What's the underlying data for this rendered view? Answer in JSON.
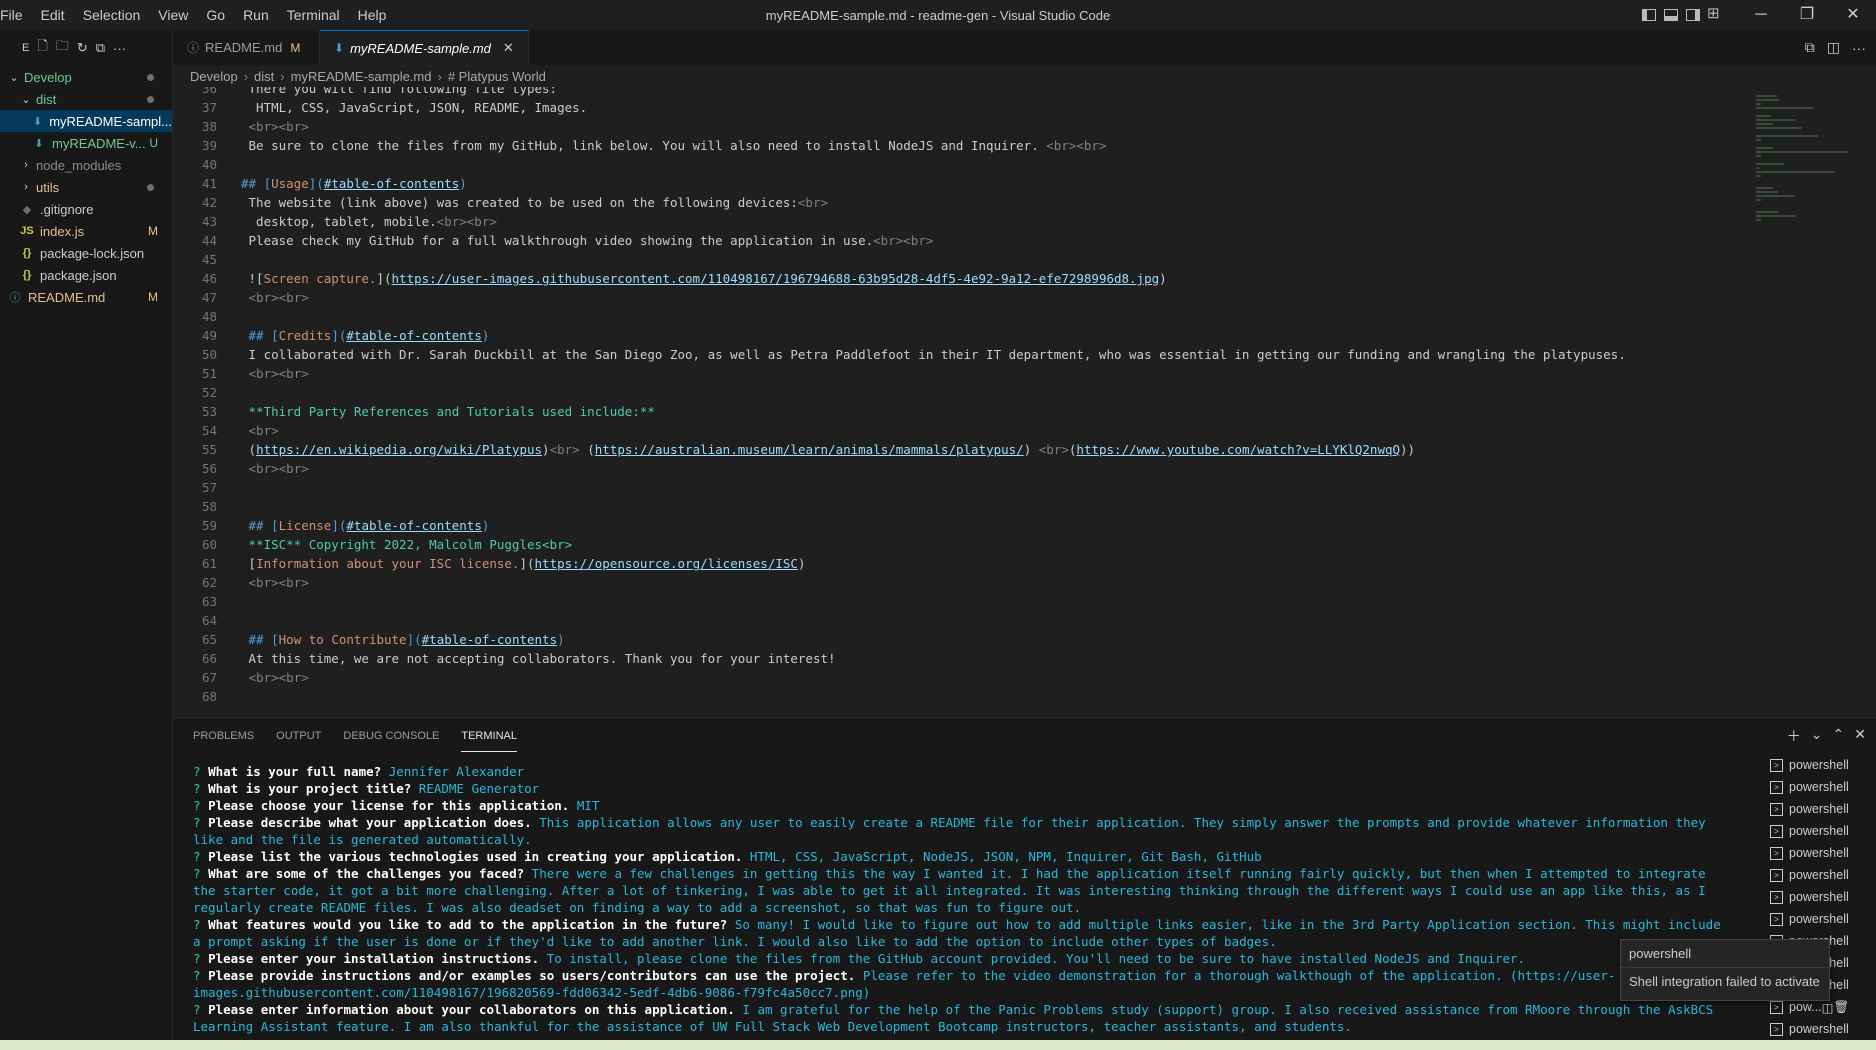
{
  "window": {
    "title": "myREADME-sample.md - readme-gen - Visual Studio Code",
    "menu": [
      "File",
      "Edit",
      "Selection",
      "View",
      "Go",
      "Run",
      "Terminal",
      "Help"
    ]
  },
  "sidebar": {
    "header_label": "E",
    "tree": [
      {
        "label": "Develop",
        "kind": "folder-open",
        "indent": 0,
        "status": "dot",
        "color": "#73c991"
      },
      {
        "label": "dist",
        "kind": "folder-open",
        "indent": 1,
        "status": "dot",
        "color": "#73c991"
      },
      {
        "label": "myREADME-sampl...",
        "kind": "md",
        "indent": 2,
        "status": "",
        "color": "#ffffff",
        "selected": true
      },
      {
        "label": "myREADME-v...",
        "kind": "md",
        "indent": 2,
        "status": "U",
        "color": "#73c991"
      },
      {
        "label": "node_modules",
        "kind": "folder",
        "indent": 1,
        "status": "",
        "color": "#8c8c8c"
      },
      {
        "label": "utils",
        "kind": "folder",
        "indent": 1,
        "status": "dot",
        "color": "#e2c08d"
      },
      {
        "label": ".gitignore",
        "kind": "git",
        "indent": 1,
        "status": "",
        "color": "#cccccc"
      },
      {
        "label": "index.js",
        "kind": "js",
        "indent": 1,
        "status": "M",
        "color": "#e2c08d"
      },
      {
        "label": "package-lock.json",
        "kind": "json",
        "indent": 1,
        "status": "",
        "color": "#cccccc"
      },
      {
        "label": "package.json",
        "kind": "json",
        "indent": 1,
        "status": "",
        "color": "#cccccc"
      },
      {
        "label": "README.md",
        "kind": "info",
        "indent": 0,
        "status": "M",
        "color": "#e2c08d"
      }
    ]
  },
  "tabs": [
    {
      "label": "README.md",
      "badge": "M",
      "active": false,
      "icon": "ⓘ"
    },
    {
      "label": "myREADME-sample.md",
      "badge": "",
      "active": true,
      "icon": "⬇"
    }
  ],
  "breadcrumb": [
    "Develop",
    "dist",
    "myREADME-sample.md",
    "# Platypus World"
  ],
  "editor": {
    "lines": [
      {
        "n": "36",
        "t": " There you will find following file types:"
      },
      {
        "n": "37",
        "t": "  HTML, CSS, JavaScript, JSON, README, Images."
      },
      {
        "n": "38",
        "t": " <br><br>"
      },
      {
        "n": "39",
        "t": " Be sure to clone the files from my GitHub, link below. You will also need to install NodeJS and Inquirer. <br><br>"
      },
      {
        "n": "40",
        "t": ""
      },
      {
        "n": "41",
        "t": "## [Usage](#table-of-contents)"
      },
      {
        "n": "42",
        "t": " The website (link above) was created to be used on the following devices:<br>"
      },
      {
        "n": "43",
        "t": "  desktop, tablet, mobile.<br><br>"
      },
      {
        "n": "44",
        "t": " Please check my GitHub for a full walkthrough video showing the application in use.<br><br>"
      },
      {
        "n": "45",
        "t": ""
      },
      {
        "n": "46",
        "t": " ![Screen capture.](https://user-images.githubusercontent.com/110498167/196794688-63b95d28-4df5-4e92-9a12-efe7298996d8.jpg)"
      },
      {
        "n": "47",
        "t": " <br><br>"
      },
      {
        "n": "48",
        "t": ""
      },
      {
        "n": "49",
        "t": " ## [Credits](#table-of-contents)"
      },
      {
        "n": "50",
        "t": " I collaborated with Dr. Sarah Duckbill at the San Diego Zoo, as well as Petra Paddlefoot in their IT department, who was essential in getting our funding and wrangling the platypuses."
      },
      {
        "n": "51",
        "t": " <br><br>"
      },
      {
        "n": "52",
        "t": ""
      },
      {
        "n": "53",
        "t": " **Third Party References and Tutorials used include:**"
      },
      {
        "n": "54",
        "t": " <br>"
      },
      {
        "n": "55",
        "t": " (https://en.wikipedia.org/wiki/Platypus)<br> (https://australian.museum/learn/animals/mammals/platypus/) <br>(https://www.youtube.com/watch?v=LLYKlQ2nwqQ))"
      },
      {
        "n": "56",
        "t": " <br><br>"
      },
      {
        "n": "57",
        "t": ""
      },
      {
        "n": "58",
        "t": ""
      },
      {
        "n": "59",
        "t": " ## [License](#table-of-contents)"
      },
      {
        "n": "60",
        "t": " **ISC** Copyright 2022, Malcolm Puggles<br>"
      },
      {
        "n": "61",
        "t": " [Information about your ISC license.](https://opensource.org/licenses/ISC)"
      },
      {
        "n": "62",
        "t": " <br><br>"
      },
      {
        "n": "63",
        "t": ""
      },
      {
        "n": "64",
        "t": ""
      },
      {
        "n": "65",
        "t": " ## [How to Contribute](#table-of-contents)"
      },
      {
        "n": "66",
        "t": " At this time, we are not accepting collaborators. Thank you for your interest!"
      },
      {
        "n": "67",
        "t": " <br><br>"
      },
      {
        "n": "68",
        "t": ""
      }
    ]
  },
  "panel": {
    "tabs": [
      "PROBLEMS",
      "OUTPUT",
      "DEBUG CONSOLE",
      "TERMINAL"
    ],
    "active_tab": "TERMINAL",
    "terminal": [
      {
        "q": "What is your full name?",
        "a": "Jennifer Alexander"
      },
      {
        "q": "What is your project title?",
        "a": "README Generator"
      },
      {
        "q": "Please choose your license for this application.",
        "a": "MIT"
      },
      {
        "q": "Please describe what your application does.",
        "a": "This application allows any user to easily create a README file for their application. They simply answer the prompts and provide whatever information they like and the file is generated automatically."
      },
      {
        "q": "Please list the various technologies used in creating your application.",
        "a": "HTML, CSS, JavaScript, NodeJS, JSON, NPM, Inquirer, Git Bash, GitHub"
      },
      {
        "q": "What are some of the challenges you faced?",
        "a": "There were a few challenges in getting this the way I wanted it. I had the application itself running fairly quickly, but then when I attempted to integrate the starter code, it got a bit more challenging. After a lot of tinkering, I was able to get it all integrated. It was interesting thinking through the different ways I could use an app like this, as I regularly create README files. I was also deadset on finding a way to add a screenshot, so that was fun to figure out."
      },
      {
        "q": "What features would you like to add to the application in the future?",
        "a": "So many! I would like to figure out how to add multiple links easier, like in the 3rd Party Application section. This might include a prompt asking if the user is done or if they'd like to add another link. I would also like to add the option to include other types of badges."
      },
      {
        "q": "Please enter your installation instructions.",
        "a": "To install, please clone the files from the GitHub account provided. You'll need to be sure to have installed NodeJS and Inquirer."
      },
      {
        "q": "Please provide instructions and/or examples so users/contributors can use the project.",
        "a": "Please refer to the video demonstration for a thorough walkthough of the application. (https://user-images.githubusercontent.com/110498167/196820569-fdd06342-5edf-4db6-9086-f79fc4a50cc7.png)"
      },
      {
        "q": "Please enter information about your collaborators on this application.",
        "a": "I am grateful for the help of the Panic Problems study (support) group. I also received assistance from RMoore through the AskBCS Learning Assistant feature. I am also thankful for the assistance of  UW Full Stack Web Development Bootcamp instructors, teacher assistants, and students."
      }
    ],
    "terminal_instances": [
      "powershell",
      "powershell",
      "powershell",
      "powershell",
      "powershell",
      "powershell",
      "powershell",
      "powershell",
      "powershell",
      "powershell",
      "powershell",
      "pow...",
      "powershell"
    ],
    "tooltip": {
      "title": "powershell",
      "message": "Shell integration failed to activate"
    }
  },
  "colors": {
    "accent": "#0078d4",
    "modified": "#e2c08d",
    "untracked": "#73c991"
  }
}
